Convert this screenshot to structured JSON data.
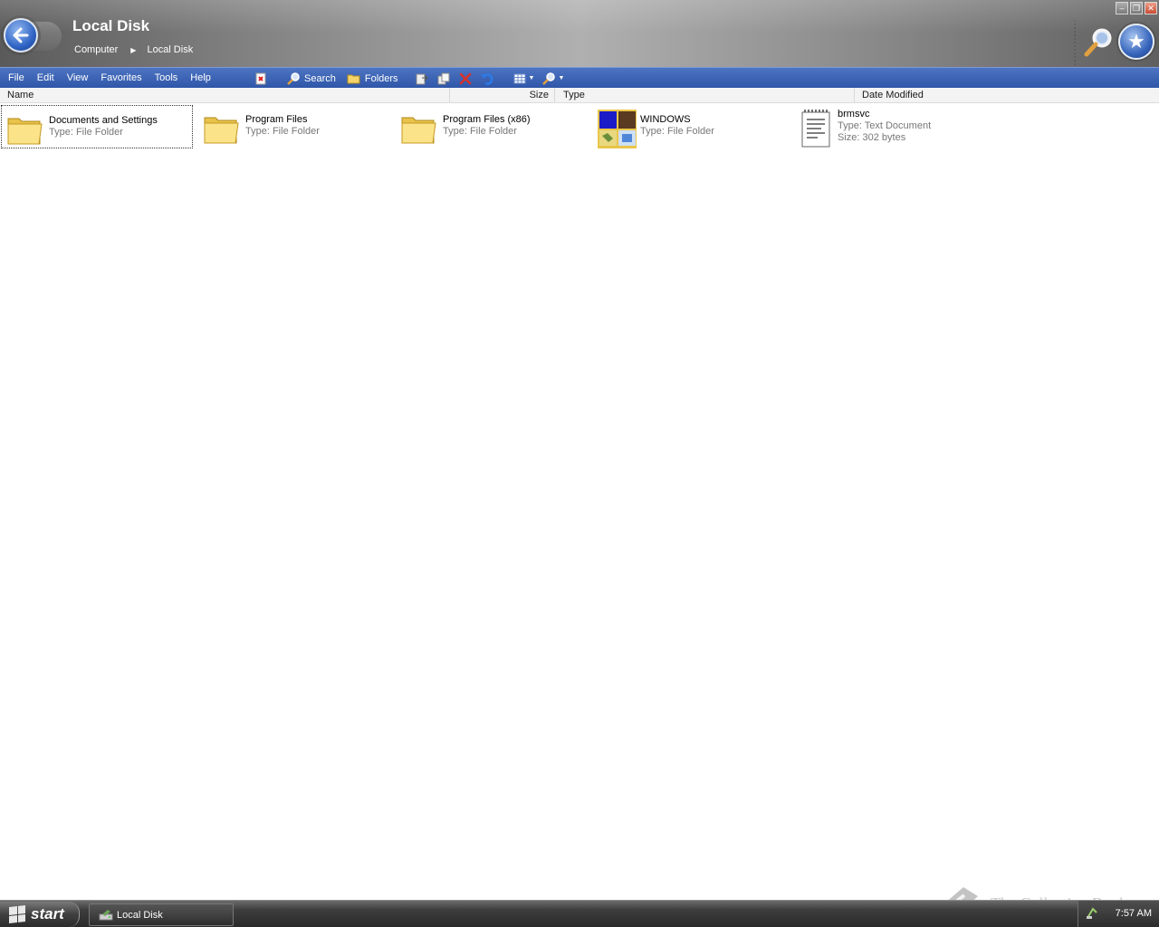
{
  "window": {
    "title": "Local Disk",
    "breadcrumb": [
      "Computer",
      "Local Disk"
    ],
    "controls": [
      "minimize-icon",
      "restore-icon",
      "close-icon"
    ]
  },
  "menu": [
    "File",
    "Edit",
    "View",
    "Favorites",
    "Tools",
    "Help"
  ],
  "toolbar": {
    "search_label": "Search",
    "folders_label": "Folders",
    "icons": [
      "stop-icon",
      "search-icon",
      "folders-icon",
      "move-to-icon",
      "copy-to-icon",
      "delete-icon",
      "undo-icon",
      "views-icon",
      "find-icon"
    ]
  },
  "columns": [
    "Name",
    "Size",
    "Type",
    "Date Modified"
  ],
  "items": [
    {
      "name": "Documents and Settings",
      "line1": "Type: File Folder",
      "line2": "",
      "icon": "folder-icon",
      "selected": true
    },
    {
      "name": "Program Files",
      "line1": "Type: File Folder",
      "line2": "",
      "icon": "folder-icon",
      "selected": false
    },
    {
      "name": "Program Files (x86)",
      "line1": "Type: File Folder",
      "line2": "",
      "icon": "folder-icon",
      "selected": false
    },
    {
      "name": "WINDOWS",
      "line1": "Type: File Folder",
      "line2": "",
      "icon": "windows-folder-icon",
      "selected": false
    },
    {
      "name": "brmsvc",
      "line1": "Type: Text Document",
      "line2": "Size: 302 bytes",
      "icon": "text-document-icon",
      "selected": false
    }
  ],
  "taskbar": {
    "start_label": "start",
    "task_label": "Local Disk",
    "clock": "7:57 AM",
    "watermark": "The Collection Book"
  }
}
